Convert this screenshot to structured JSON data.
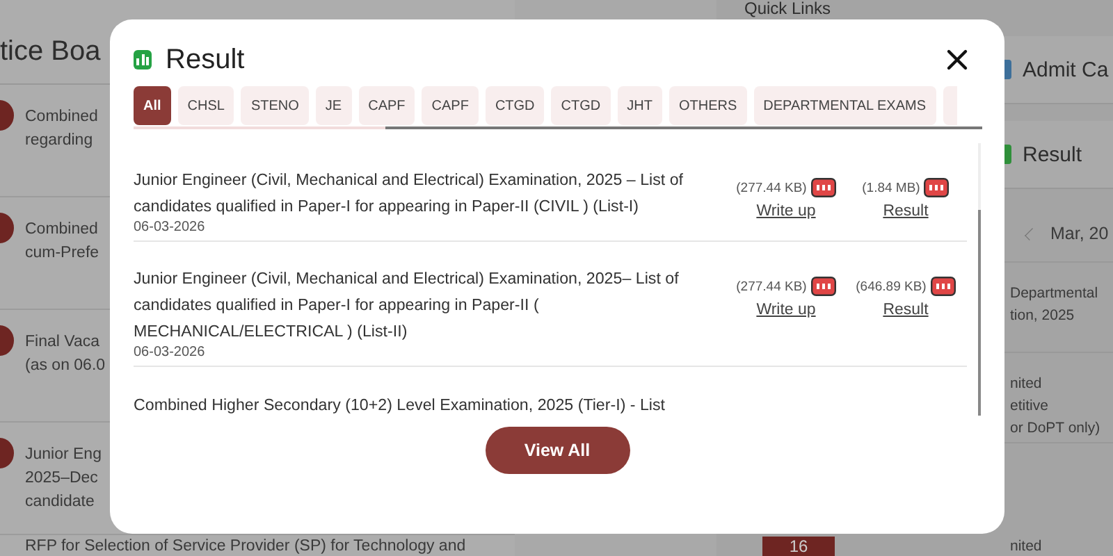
{
  "background": {
    "notice_board": {
      "title": "tice Boa",
      "items": [
        {
          "lines": [
            "Combined",
            "regarding"
          ]
        },
        {
          "lines": [
            "Combined",
            "cum-Prefe"
          ]
        },
        {
          "lines": [
            "Final Vaca",
            "(as on 06.0"
          ]
        },
        {
          "lines": [
            "Junior Eng",
            "2025–Dec",
            "candidate"
          ]
        },
        {
          "lines": [
            "RFP for Selection of Service Provider (SP) for Technology and"
          ]
        }
      ]
    },
    "quick_links": {
      "title": "Quick Links",
      "links": [
        {
          "label": "Admit Ca",
          "kind": "admit"
        },
        {
          "label": "Result",
          "kind": "result"
        }
      ],
      "calendar": {
        "month": "Mar, 20",
        "events": [
          {
            "lines": [
              "Departmental",
              "tion, 2025"
            ]
          },
          {
            "lines": [
              "nited",
              "etitive",
              "or DoPT only)"
            ]
          },
          {
            "day": "16",
            "lines": [
              "nited"
            ]
          }
        ]
      }
    }
  },
  "dialog": {
    "title": "Result",
    "tabs": [
      {
        "label": "All",
        "selected": true
      },
      {
        "label": "CHSL",
        "selected": false
      },
      {
        "label": "STENO",
        "selected": false
      },
      {
        "label": "JE",
        "selected": false
      },
      {
        "label": "CAPF",
        "selected": false
      },
      {
        "label": "CAPF",
        "selected": false
      },
      {
        "label": "CTGD",
        "selected": false
      },
      {
        "label": "CTGD",
        "selected": false
      },
      {
        "label": "JHT",
        "selected": false
      },
      {
        "label": "OTHERS",
        "selected": false
      },
      {
        "label": "DEPARTMENTAL EXAMS",
        "selected": false
      }
    ],
    "results": [
      {
        "title": "Junior Engineer (Civil, Mechanical and Electrical) Examination, 2025 – List of candidates qualified in Paper-I for appearing in Paper-II (CIVIL ) (List-I)",
        "date": "06-03-2026",
        "files": [
          {
            "size": "(277.44 KB)",
            "link": "Write up"
          },
          {
            "size": "(1.84 MB)",
            "link": "Result"
          }
        ]
      },
      {
        "title": "Junior Engineer (Civil, Mechanical and Electrical) Examination, 2025– List of candidates qualified in Paper-I for appearing in Paper-II ( MECHANICAL/ELECTRICAL ) (List-II)",
        "date": "06-03-2026",
        "files": [
          {
            "size": "(277.44 KB)",
            "link": "Write up"
          },
          {
            "size": "(646.89 KB)",
            "link": "Result"
          }
        ]
      },
      {
        "title": "Combined Higher Secondary (10+2) Level Examination, 2025 (Tier-I) - List"
      }
    ],
    "button": "View All"
  }
}
